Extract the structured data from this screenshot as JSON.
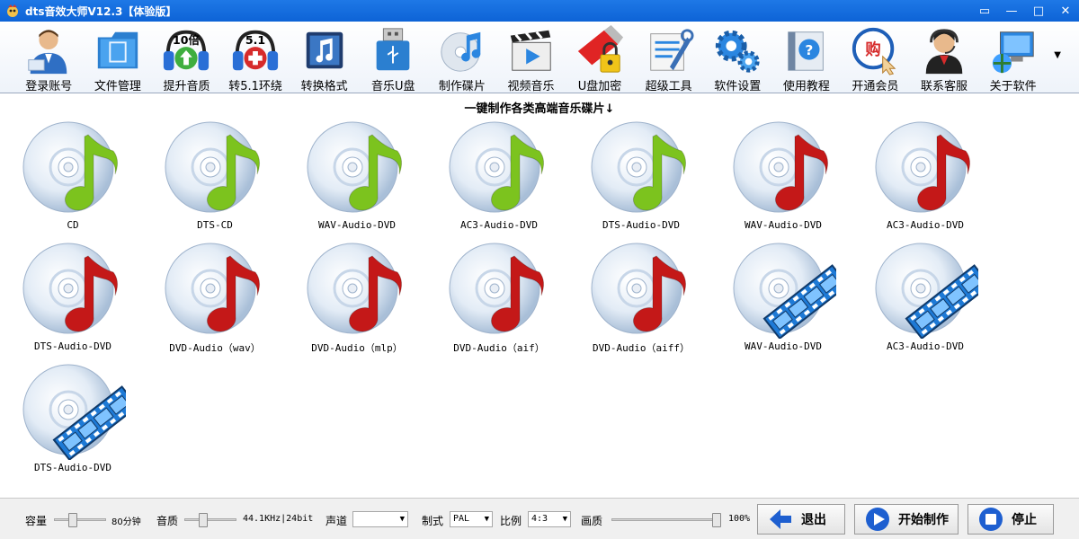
{
  "window": {
    "title": "dts音效大师V12.3【体验版】",
    "controls": [
      "▭",
      "—",
      "□",
      "✕"
    ]
  },
  "toolbar": {
    "items": [
      {
        "label": "登录账号",
        "icon": "user-login-icon"
      },
      {
        "label": "文件管理",
        "icon": "folder-icon"
      },
      {
        "label": "提升音质",
        "icon": "headphones-10x-icon",
        "badge": "10倍"
      },
      {
        "label": "转5.1环绕",
        "icon": "headphones-51-icon",
        "badge": "5.1"
      },
      {
        "label": "转换格式",
        "icon": "music-note-convert-icon"
      },
      {
        "label": "音乐U盘",
        "icon": "usb-drive-icon"
      },
      {
        "label": "制作碟片",
        "icon": "music-disc-icon"
      },
      {
        "label": "视频音乐",
        "icon": "video-clapper-icon"
      },
      {
        "label": "U盘加密",
        "icon": "usb-lock-icon"
      },
      {
        "label": "超级工具",
        "icon": "tools-icon"
      },
      {
        "label": "软件设置",
        "icon": "gear-icon"
      },
      {
        "label": "使用教程",
        "icon": "help-book-icon"
      },
      {
        "label": "开通会员",
        "icon": "vip-buy-icon",
        "badge": "购"
      },
      {
        "label": "联系客服",
        "icon": "support-agent-icon"
      },
      {
        "label": "关于软件",
        "icon": "about-computer-icon"
      }
    ]
  },
  "main": {
    "header": "一键制作各类高端音乐碟片↓",
    "discs": [
      {
        "label": "CD",
        "type": "green"
      },
      {
        "label": "DTS-CD",
        "type": "green"
      },
      {
        "label": "WAV-Audio-DVD",
        "type": "green"
      },
      {
        "label": "AC3-Audio-DVD",
        "type": "green"
      },
      {
        "label": "DTS-Audio-DVD",
        "type": "green"
      },
      {
        "label": "WAV-Audio-DVD",
        "type": "red"
      },
      {
        "label": "AC3-Audio-DVD",
        "type": "red"
      },
      {
        "label": "DTS-Audio-DVD",
        "type": "red"
      },
      {
        "label": "DVD-Audio（wav）",
        "type": "red"
      },
      {
        "label": "DVD-Audio（mlp）",
        "type": "red"
      },
      {
        "label": "DVD-Audio（aif）",
        "type": "red"
      },
      {
        "label": "DVD-Audio（aiff）",
        "type": "red"
      },
      {
        "label": "WAV-Audio-DVD",
        "type": "film"
      },
      {
        "label": "AC3-Audio-DVD",
        "type": "film"
      },
      {
        "label": "DTS-Audio-DVD",
        "type": "film"
      }
    ]
  },
  "bottom": {
    "capacity_label": "容量",
    "capacity_value": "80分钟",
    "capacity_level": 0.45,
    "quality_label": "音质",
    "quality_value": "44.1KHz|24bit",
    "quality_level": 0.45,
    "channel_label": "声道",
    "channel_value": "",
    "standard_label": "制式",
    "standard_value": "PAL",
    "ratio_label": "比例",
    "ratio_value": "4:3",
    "picture_label": "画质",
    "picture_value": "100%",
    "picture_level": 1.0,
    "exit_label": "退出",
    "start_label": "开始制作",
    "stop_label": "停止"
  },
  "colors": {
    "titlebar": "#1e78e6",
    "note_green": "#7cc31e",
    "note_red": "#c41818",
    "film_blue": "#1e7ad6"
  }
}
